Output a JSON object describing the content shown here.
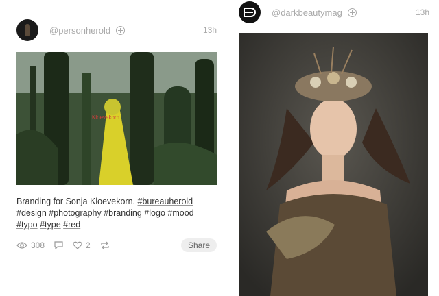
{
  "left_post": {
    "username": "@personherold",
    "time": "13h",
    "caption_text": "Branding for Sonja Kloevekorn.",
    "tags": [
      "#bureauherold",
      "#design",
      "#photography",
      "#branding",
      "#logo",
      "#mood",
      "#typo",
      "#type",
      "#red"
    ],
    "views": "308",
    "likes": "2",
    "share_label": "Share"
  },
  "right_post": {
    "username": "@darkbeautymag",
    "time": "13h"
  },
  "icons": [
    "follow-icon",
    "eye-icon",
    "comment-icon",
    "heart-icon",
    "repost-icon"
  ]
}
